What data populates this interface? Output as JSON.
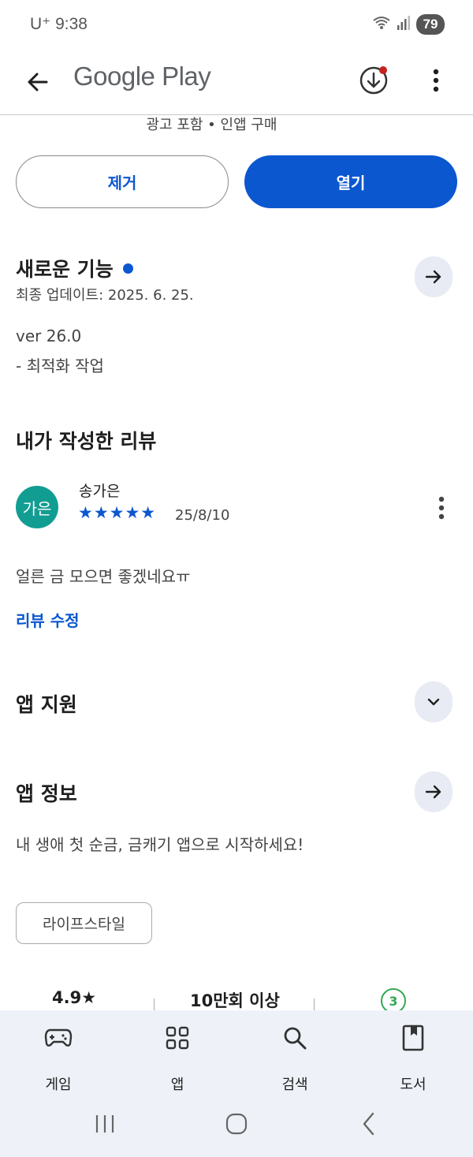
{
  "status_bar": {
    "carrier": "U⁺ 9:38",
    "battery": "79"
  },
  "header": {
    "title": "Google Play"
  },
  "app_meta": {
    "info": "광고 포함 • 인앱 구매"
  },
  "actions": {
    "remove_label": "제거",
    "open_label": "열기"
  },
  "whats_new": {
    "title": "새로운 기능",
    "updated": "최종 업데이트: 2025. 6. 25.",
    "version": "ver 26.0",
    "note": "- 최적화 작업"
  },
  "my_review": {
    "title": "내가 작성한 리뷰",
    "avatar_text": "가은",
    "reviewer": "송가은",
    "stars": "★★★★★",
    "rating": 5,
    "date": "25/8/10",
    "text": "얼른 금 모으면 좋겠네요ㅠ",
    "edit_label": "리뷰 수정"
  },
  "app_support": {
    "title": "앱 지원"
  },
  "app_info": {
    "title": "앱 정보",
    "description": "내 생애 첫 순금, 금캐기 앱으로 시작하세요!",
    "category": "라이프스타일"
  },
  "stats": {
    "rating": "4.9★",
    "downloads": "10만회 이상",
    "age_rating": "3"
  },
  "bottom_nav": {
    "items": [
      {
        "label": "게임",
        "icon": "gamepad-icon"
      },
      {
        "label": "앱",
        "icon": "apps-grid-icon"
      },
      {
        "label": "검색",
        "icon": "search-icon"
      },
      {
        "label": "도서",
        "icon": "book-icon"
      }
    ]
  },
  "colors": {
    "accent": "#0b57d0",
    "avatar": "#129d92",
    "age_badge": "#34a853",
    "nav_bg": "#eef2f8"
  }
}
